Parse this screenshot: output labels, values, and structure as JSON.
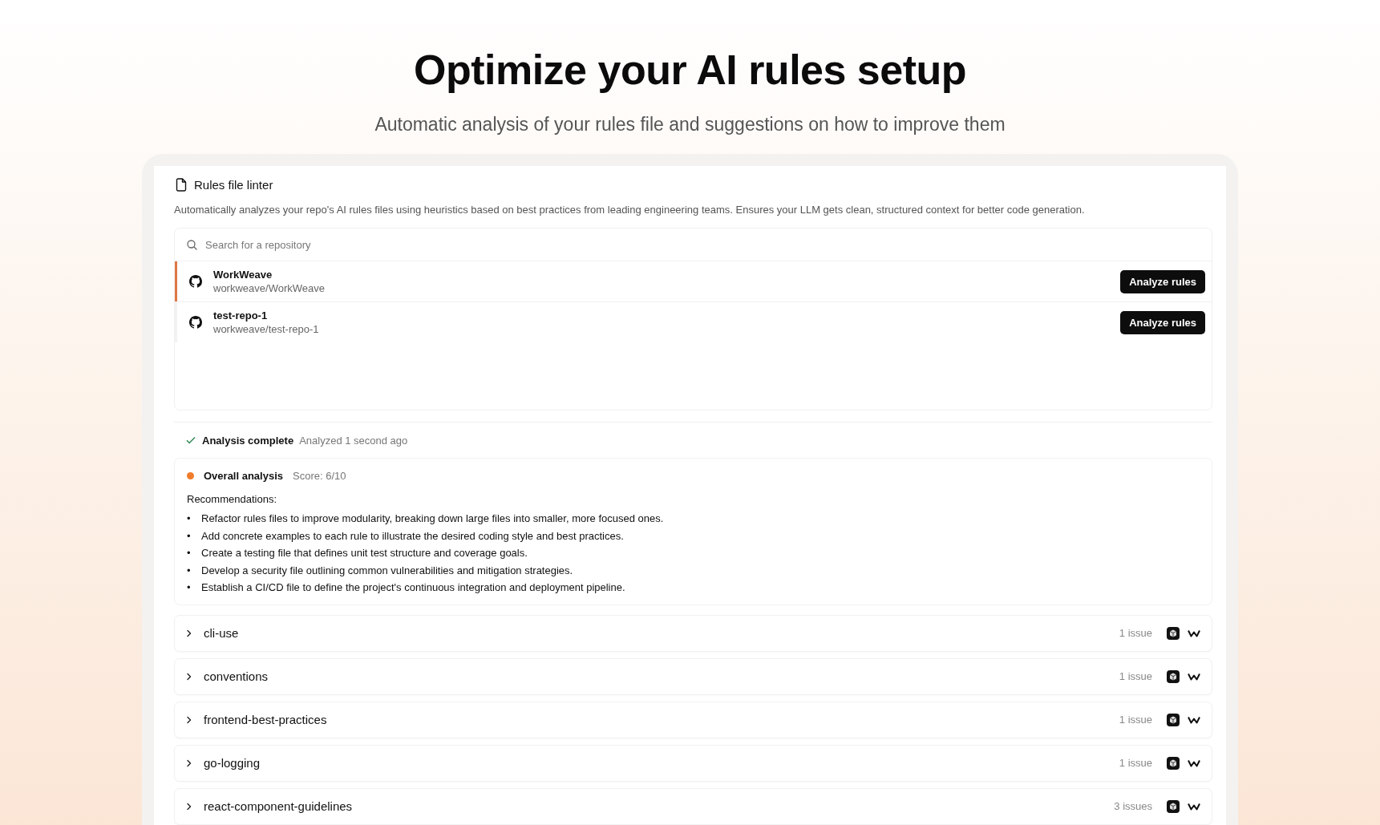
{
  "header": {
    "title": "Optimize your AI rules setup",
    "subtitle": "Automatic analysis of your rules file and suggestions on how to improve them"
  },
  "linter": {
    "title": "Rules file linter",
    "description": "Automatically analyzes your repo's AI rules files using heuristics based on best practices from leading engineering teams. Ensures your LLM gets clean, structured context for better code generation.",
    "search": {
      "placeholder": "Search for a repository"
    },
    "repos": [
      {
        "name": "WorkWeave",
        "path": "workweave/WorkWeave",
        "button": "Analyze rules",
        "selected": true
      },
      {
        "name": "test-repo-1",
        "path": "workweave/test-repo-1",
        "button": "Analyze rules",
        "selected": false
      }
    ]
  },
  "analysis": {
    "status": "Analysis complete",
    "time": "Analyzed 1 second ago",
    "overall": {
      "title": "Overall analysis",
      "score": "Score: 6/10",
      "color": "#f07c2a",
      "heading": "Recommendations:",
      "items": [
        {
          "bullet": "•",
          "text": "Refactor rules files to improve modularity, breaking down large files into smaller, more focused ones."
        },
        {
          "bullet": "•",
          "text": "Add concrete examples to each rule to illustrate the desired coding style and best practices."
        },
        {
          "bullet": "•",
          "text": "Create a testing file that defines unit test structure and coverage goals."
        },
        {
          "bullet": "•",
          "text": "Develop a security file outlining common vulnerabilities and mitigation strategies."
        },
        {
          "bullet": "•",
          "text": "Establish a CI/CD file to define the project's continuous integration and deployment pipeline."
        }
      ]
    }
  },
  "rules": [
    {
      "name": "cli-use",
      "issues": "1 issue",
      "expanded": false
    },
    {
      "name": "conventions",
      "issues": "1 issue",
      "expanded": false
    },
    {
      "name": "frontend-best-practices",
      "issues": "1 issue",
      "expanded": false
    },
    {
      "name": "go-logging",
      "issues": "1 issue",
      "expanded": false
    },
    {
      "name": "react-component-guidelines",
      "issues": "3 issues",
      "expanded": false
    }
  ]
}
